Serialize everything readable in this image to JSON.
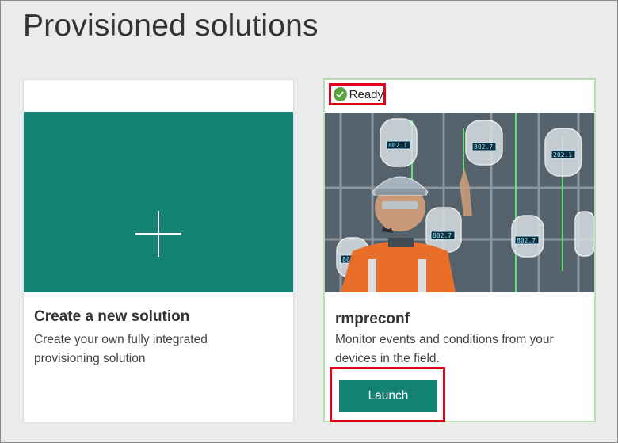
{
  "page": {
    "title": "Provisioned solutions"
  },
  "create_card": {
    "title": "Create a new solution",
    "description": "Create your own fully integrated provisioning solution",
    "tile_color": "#138272",
    "icon": "plus-icon"
  },
  "solution_card": {
    "status": "Ready",
    "status_icon": "check-circle-icon",
    "status_color": "#58a33f",
    "name": "rmpreconf",
    "description": "Monitor events and conditions from your devices in the field.",
    "launch_label": "Launch",
    "accent": "#138272",
    "highlight_color": "#e0001b",
    "hero_image": "engineer-with-hardhat-and-industrial-monitoring-overlay",
    "gauge_readouts": [
      "802.1",
      "802.7",
      "202.1",
      "802.7",
      "802.7",
      "802.7"
    ]
  }
}
